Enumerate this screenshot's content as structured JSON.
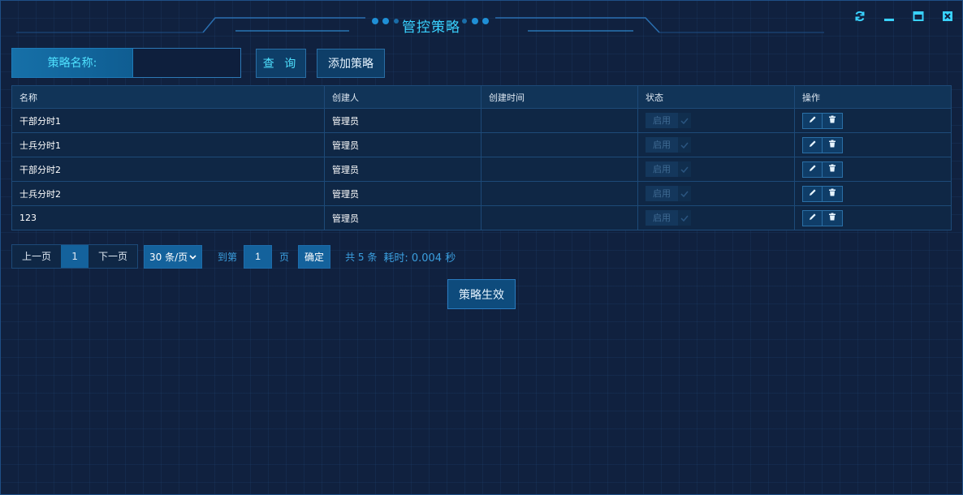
{
  "window": {
    "title": "管控策略",
    "controls": [
      "refresh-icon",
      "minimize-icon",
      "maximize-icon",
      "close-icon"
    ],
    "accent_color": "#39d2ff"
  },
  "search": {
    "label": "策略名称:",
    "value": "",
    "query_label": "查 询",
    "add_label": "添加策略"
  },
  "table": {
    "headers": [
      "名称",
      "创建人",
      "创建时间",
      "状态",
      "操作"
    ],
    "rows": [
      {
        "name": "干部分时1",
        "creator": "管理员",
        "created": "",
        "status": "启用"
      },
      {
        "name": "士兵分时1",
        "creator": "管理员",
        "created": "",
        "status": "启用"
      },
      {
        "name": "干部分时2",
        "creator": "管理员",
        "created": "",
        "status": "启用"
      },
      {
        "name": "士兵分时2",
        "creator": "管理员",
        "created": "",
        "status": "启用"
      },
      {
        "name": "123",
        "creator": "管理员",
        "created": "",
        "status": "启用"
      }
    ],
    "action_icons": [
      "edit-icon",
      "delete-icon"
    ]
  },
  "pagination": {
    "prev_label": "上一页",
    "current_page": "1",
    "next_label": "下一页",
    "page_size_selected": "30 条/页",
    "goto_label": "到第",
    "goto_value": "1",
    "page_unit": "页",
    "confirm_label": "确定",
    "total_text": "共 5 条",
    "elapsed_text": "耗时: 0.004 秒"
  },
  "apply_label": "策略生效"
}
